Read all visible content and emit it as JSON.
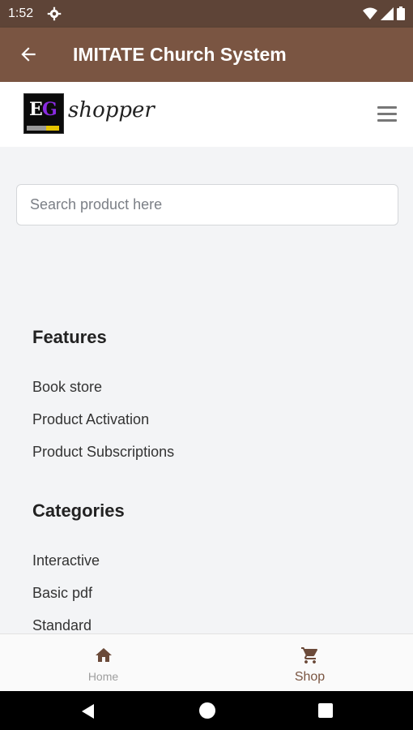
{
  "status_bar": {
    "time": "1:52",
    "icons": [
      "gear-icon",
      "wifi-icon",
      "signal-icon",
      "battery-icon"
    ]
  },
  "app_bar": {
    "title": "IMITATE Church System",
    "back_icon": "arrow-left-icon"
  },
  "brand": {
    "logo_text": "EG",
    "name": "shopper",
    "menu_icon": "hamburger-icon"
  },
  "search": {
    "placeholder": "Search product here",
    "value": ""
  },
  "features": {
    "heading": "Features",
    "items": [
      "Book store",
      "Product Activation",
      "Product Subscriptions"
    ]
  },
  "categories": {
    "heading": "Categories",
    "items": [
      "Interactive",
      "Basic pdf",
      "Standard"
    ]
  },
  "bottom_nav": [
    {
      "label": "Home",
      "icon": "home-icon"
    },
    {
      "label": "Shop",
      "icon": "cart-icon",
      "active": true
    }
  ],
  "system_nav": {
    "icons": [
      "back-triangle-icon",
      "home-circle-icon",
      "recents-square-icon"
    ]
  },
  "colors": {
    "app_bar": "#7a5542",
    "status_bar": "#5e4437",
    "background": "#f3f4f6"
  }
}
